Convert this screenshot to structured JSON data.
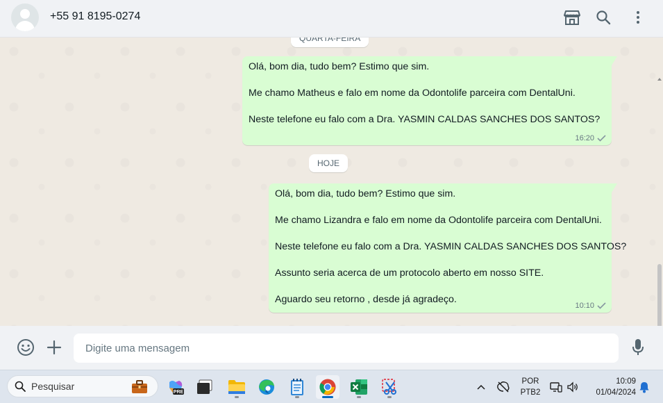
{
  "header": {
    "contact_name": "+55 91 8195-0274",
    "icons": [
      "avatar",
      "catalog-store-icon",
      "search-icon",
      "menu-dots-icon"
    ]
  },
  "chat": {
    "date_chips": {
      "previous": "QUARTA-FEIRA",
      "today": "HOJE"
    },
    "messages": [
      {
        "lines": [
          "Olá, bom dia, tudo bem? Estimo que sim.",
          "",
          "Me chamo Matheus e falo em nome da Odontolife parceira com DentalUni.",
          "",
          "Neste telefone eu falo com a Dra. YASMIN CALDAS SANCHES DOS SANTOS?"
        ],
        "time": "16:20",
        "status": "sent-check"
      },
      {
        "lines": [
          "Olá, bom dia, tudo bem? Estimo que sim.",
          "",
          "Me chamo Lizandra e falo em nome da Odontolife parceira com DentalUni.",
          "",
          "Neste telefone eu falo com a Dra. YASMIN CALDAS SANCHES DOS SANTOS?",
          "",
          "Assunto seria acerca de um protocolo aberto em nosso SITE.",
          "",
          "Aguardo seu retorno , desde já agradeço."
        ],
        "time": "10:10",
        "status": "sent-check"
      }
    ]
  },
  "composer": {
    "placeholder": "Digite uma mensagem",
    "icons": [
      "emoji-icon",
      "plus-icon",
      "microphone-icon"
    ]
  },
  "taskbar": {
    "search_placeholder": "Pesquisar",
    "apps": [
      "work-briefcase-icon",
      "copilot-pre-icon",
      "terminal-icon",
      "file-explorer-icon",
      "edge-icon",
      "notepad-icon",
      "chrome-icon",
      "excel-icon",
      "snipping-tool-icon"
    ],
    "tray": {
      "language": "POR",
      "keyboard": "PTB2",
      "time": "10:09",
      "date": "01/04/2024"
    }
  },
  "colors": {
    "outgoing_bubble": "#d9fdd3",
    "chat_background": "#efeae2",
    "header_background": "#f0f2f5",
    "check_color": "#8696a0",
    "taskbar_background": "#dee5ee"
  }
}
